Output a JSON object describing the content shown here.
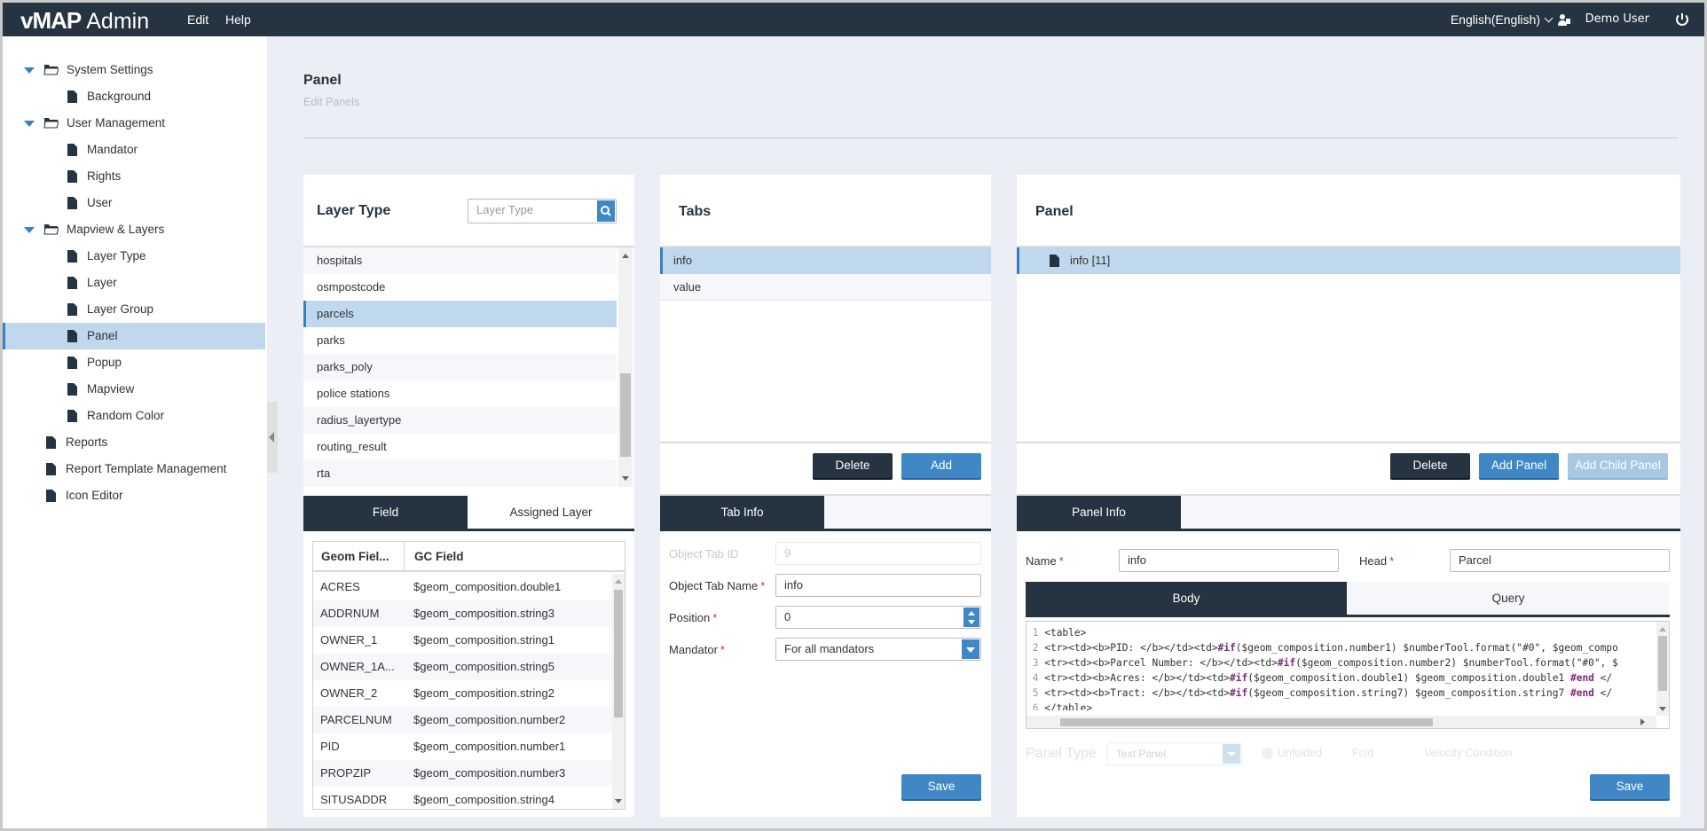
{
  "header": {
    "logo_bold": "vMAP",
    "logo_text": "Admin",
    "menu": [
      "Edit",
      "Help"
    ],
    "language": "English(English)",
    "user": "Demo User"
  },
  "sidebar": {
    "items": [
      {
        "label": "System Settings",
        "level": 0,
        "type": "folder",
        "expanded": true
      },
      {
        "label": "Background",
        "level": 1,
        "type": "file"
      },
      {
        "label": "User Management",
        "level": 0,
        "type": "folder",
        "expanded": true
      },
      {
        "label": "Mandator",
        "level": 1,
        "type": "file"
      },
      {
        "label": "Rights",
        "level": 1,
        "type": "file"
      },
      {
        "label": "User",
        "level": 1,
        "type": "file"
      },
      {
        "label": "Mapview & Layers",
        "level": 0,
        "type": "folder",
        "expanded": true
      },
      {
        "label": "Layer Type",
        "level": 1,
        "type": "file"
      },
      {
        "label": "Layer",
        "level": 1,
        "type": "file"
      },
      {
        "label": "Layer Group",
        "level": 1,
        "type": "file"
      },
      {
        "label": "Panel",
        "level": 1,
        "type": "file",
        "selected": true
      },
      {
        "label": "Popup",
        "level": 1,
        "type": "file"
      },
      {
        "label": "Mapview",
        "level": 1,
        "type": "file"
      },
      {
        "label": "Random Color",
        "level": 1,
        "type": "file"
      },
      {
        "label": "Reports",
        "level": 0,
        "type": "file"
      },
      {
        "label": "Report Template Management",
        "level": 0,
        "type": "file"
      },
      {
        "label": "Icon Editor",
        "level": 0,
        "type": "file"
      }
    ]
  },
  "page": {
    "title": "Panel",
    "subtitle": "Edit Panels"
  },
  "layer_type": {
    "title": "Layer Type",
    "search_placeholder": "Layer Type",
    "items": [
      "hospitals",
      "osmpostcode",
      "parcels",
      "parks",
      "parks_poly",
      "police stations",
      "radius_layertype",
      "routing_result",
      "rta"
    ],
    "selected": "parcels",
    "tabs": [
      "Field",
      "Assigned Layer"
    ],
    "grid": {
      "headers": [
        "Geom Fiel...",
        "GC Field"
      ],
      "rows": [
        [
          "ACRES",
          "$geom_composition.double1"
        ],
        [
          "ADDRNUM",
          "$geom_composition.string3"
        ],
        [
          "OWNER_1",
          "$geom_composition.string1"
        ],
        [
          "OWNER_1A...",
          "$geom_composition.string5"
        ],
        [
          "OWNER_2",
          "$geom_composition.string2"
        ],
        [
          "PARCELNUM",
          "$geom_composition.number2"
        ],
        [
          "PID",
          "$geom_composition.number1"
        ],
        [
          "PROPZIP",
          "$geom_composition.number3"
        ],
        [
          "SITUSADDR",
          "$geom_composition.string4"
        ]
      ]
    }
  },
  "tabs_card": {
    "title": "Tabs",
    "items": [
      "info",
      "value"
    ],
    "selected": "info",
    "delete_label": "Delete",
    "add_label": "Add",
    "tab_info_label": "Tab Info",
    "form": {
      "id_label": "Object Tab ID",
      "id_value": "9",
      "name_label": "Object Tab Name",
      "name_value": "info",
      "position_label": "Position",
      "position_value": "0",
      "mandator_label": "Mandator",
      "mandator_value": "For all mandators"
    },
    "save_label": "Save"
  },
  "panel_card": {
    "title": "Panel",
    "tree_item": "info [11]",
    "delete_label": "Delete",
    "add_panel_label": "Add Panel",
    "add_child_label": "Add Child Panel",
    "panel_info_label": "Panel Info",
    "name_label": "Name",
    "name_value": "info",
    "head_label": "Head",
    "head_value": "Parcel",
    "editor_tabs": [
      "Body",
      "Query"
    ],
    "code_lines": [
      "<table>",
      "<tr><td><b>PID: </b></td><td>#if($geom_composition.number1) $numberTool.format(\"#0\", $geom_compo",
      "<tr><td><b>Parcel Number: </b></td><td>#if($geom_composition.number2) $numberTool.format(\"#0\", $",
      "<tr><td><b>Acres: </b></td><td>#if($geom_composition.double1) $geom_composition.double1 #end </",
      "<tr><td><b>Tract: </b></td><td>#if($geom_composition.string7) $geom_composition.string7 #end </",
      "</table>"
    ],
    "panel_type_label": "Panel Type",
    "panel_type_value": "Text Panel",
    "radio_options": [
      "Unfolded",
      "Fold",
      "Velocity Condition"
    ],
    "save_label": "Save"
  }
}
